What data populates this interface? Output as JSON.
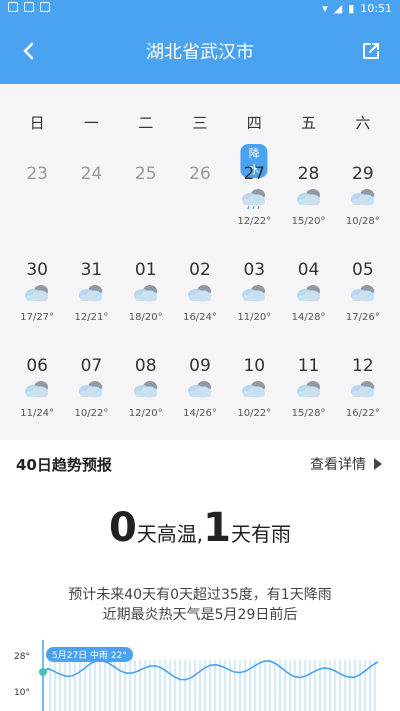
{
  "status_bar": {
    "time": "10:51"
  },
  "app_bar": {
    "title": "湖北省武汉市"
  },
  "calendar": {
    "weekdays": [
      "日",
      "一",
      "二",
      "三",
      "四",
      "五",
      "六"
    ],
    "rows": [
      [
        {
          "day": "23",
          "past": true
        },
        {
          "day": "24",
          "past": true
        },
        {
          "day": "25",
          "past": true
        },
        {
          "day": "26",
          "past": true
        },
        {
          "day": "27",
          "badge": "降水",
          "weather": "rain-cloud-icon",
          "temp": "12/22°"
        },
        {
          "day": "28",
          "weather": "cloudy-icon",
          "temp": "15/20°"
        },
        {
          "day": "29",
          "weather": "cloudy-icon",
          "temp": "10/28°"
        }
      ],
      [
        {
          "day": "30",
          "weather": "cloudy-icon",
          "temp": "17/27°"
        },
        {
          "day": "31",
          "weather": "cloudy-icon",
          "temp": "12/21°"
        },
        {
          "day": "01",
          "weather": "cloudy-icon",
          "temp": "18/20°"
        },
        {
          "day": "02",
          "weather": "cloudy-icon",
          "temp": "16/24°"
        },
        {
          "day": "03",
          "weather": "cloudy-icon",
          "temp": "11/20°"
        },
        {
          "day": "04",
          "weather": "cloudy-icon",
          "temp": "14/28°"
        },
        {
          "day": "05",
          "weather": "cloudy-icon",
          "temp": "17/26°"
        }
      ],
      [
        {
          "day": "06",
          "weather": "cloudy-icon",
          "temp": "11/24°"
        },
        {
          "day": "07",
          "weather": "cloudy-icon",
          "temp": "10/22°"
        },
        {
          "day": "08",
          "weather": "cloudy-icon",
          "temp": "12/20°"
        },
        {
          "day": "09",
          "weather": "cloudy-icon",
          "temp": "14/26°"
        },
        {
          "day": "10",
          "weather": "cloudy-icon",
          "temp": "10/22°"
        },
        {
          "day": "11",
          "weather": "cloudy-icon",
          "temp": "15/28°"
        },
        {
          "day": "12",
          "weather": "cloudy-icon",
          "temp": "16/22°"
        }
      ]
    ],
    "page_dots": 3,
    "active_dot": 0
  },
  "trend": {
    "title": "40日趋势预报",
    "detail_label": "查看详情"
  },
  "summary": {
    "hot_days": "0",
    "hot_label": "天高温,",
    "rain_days": "1",
    "rain_label": "天有雨"
  },
  "forecast_text": {
    "line1": "预计未来40天有0天超过35度，有1天降雨",
    "line2": "近期最炎热天气是5月29日前后"
  },
  "mini_chart": {
    "ytick_high": "28°",
    "ytick_low": "10°",
    "label": "5月27日 中雨 22°",
    "accent": "#4aa3f0"
  },
  "colors": {
    "accent": "#4aa3f0",
    "background": "#f5f5f7"
  }
}
